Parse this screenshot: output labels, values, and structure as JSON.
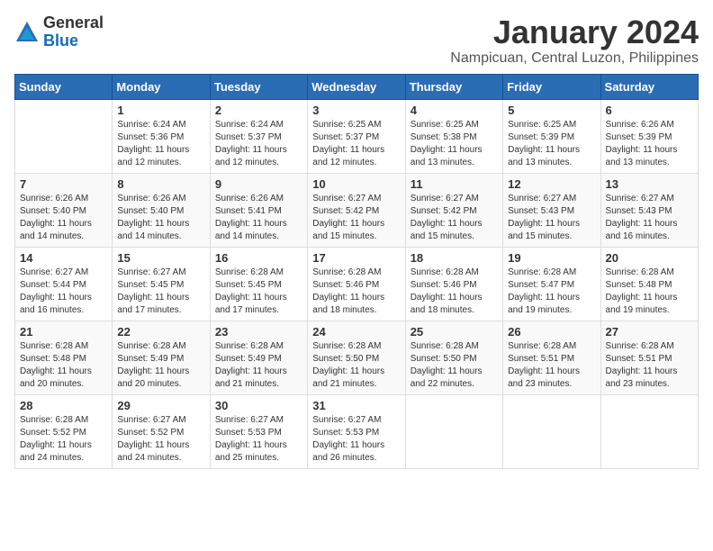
{
  "header": {
    "logo": {
      "general": "General",
      "blue": "Blue"
    },
    "title": "January 2024",
    "location": "Nampicuan, Central Luzon, Philippines"
  },
  "days_of_week": [
    "Sunday",
    "Monday",
    "Tuesday",
    "Wednesday",
    "Thursday",
    "Friday",
    "Saturday"
  ],
  "weeks": [
    [
      {
        "day": "",
        "info": ""
      },
      {
        "day": "1",
        "info": "Sunrise: 6:24 AM\nSunset: 5:36 PM\nDaylight: 11 hours\nand 12 minutes."
      },
      {
        "day": "2",
        "info": "Sunrise: 6:24 AM\nSunset: 5:37 PM\nDaylight: 11 hours\nand 12 minutes."
      },
      {
        "day": "3",
        "info": "Sunrise: 6:25 AM\nSunset: 5:37 PM\nDaylight: 11 hours\nand 12 minutes."
      },
      {
        "day": "4",
        "info": "Sunrise: 6:25 AM\nSunset: 5:38 PM\nDaylight: 11 hours\nand 13 minutes."
      },
      {
        "day": "5",
        "info": "Sunrise: 6:25 AM\nSunset: 5:39 PM\nDaylight: 11 hours\nand 13 minutes."
      },
      {
        "day": "6",
        "info": "Sunrise: 6:26 AM\nSunset: 5:39 PM\nDaylight: 11 hours\nand 13 minutes."
      }
    ],
    [
      {
        "day": "7",
        "info": "Sunrise: 6:26 AM\nSunset: 5:40 PM\nDaylight: 11 hours\nand 14 minutes."
      },
      {
        "day": "8",
        "info": "Sunrise: 6:26 AM\nSunset: 5:40 PM\nDaylight: 11 hours\nand 14 minutes."
      },
      {
        "day": "9",
        "info": "Sunrise: 6:26 AM\nSunset: 5:41 PM\nDaylight: 11 hours\nand 14 minutes."
      },
      {
        "day": "10",
        "info": "Sunrise: 6:27 AM\nSunset: 5:42 PM\nDaylight: 11 hours\nand 15 minutes."
      },
      {
        "day": "11",
        "info": "Sunrise: 6:27 AM\nSunset: 5:42 PM\nDaylight: 11 hours\nand 15 minutes."
      },
      {
        "day": "12",
        "info": "Sunrise: 6:27 AM\nSunset: 5:43 PM\nDaylight: 11 hours\nand 15 minutes."
      },
      {
        "day": "13",
        "info": "Sunrise: 6:27 AM\nSunset: 5:43 PM\nDaylight: 11 hours\nand 16 minutes."
      }
    ],
    [
      {
        "day": "14",
        "info": "Sunrise: 6:27 AM\nSunset: 5:44 PM\nDaylight: 11 hours\nand 16 minutes."
      },
      {
        "day": "15",
        "info": "Sunrise: 6:27 AM\nSunset: 5:45 PM\nDaylight: 11 hours\nand 17 minutes."
      },
      {
        "day": "16",
        "info": "Sunrise: 6:28 AM\nSunset: 5:45 PM\nDaylight: 11 hours\nand 17 minutes."
      },
      {
        "day": "17",
        "info": "Sunrise: 6:28 AM\nSunset: 5:46 PM\nDaylight: 11 hours\nand 18 minutes."
      },
      {
        "day": "18",
        "info": "Sunrise: 6:28 AM\nSunset: 5:46 PM\nDaylight: 11 hours\nand 18 minutes."
      },
      {
        "day": "19",
        "info": "Sunrise: 6:28 AM\nSunset: 5:47 PM\nDaylight: 11 hours\nand 19 minutes."
      },
      {
        "day": "20",
        "info": "Sunrise: 6:28 AM\nSunset: 5:48 PM\nDaylight: 11 hours\nand 19 minutes."
      }
    ],
    [
      {
        "day": "21",
        "info": "Sunrise: 6:28 AM\nSunset: 5:48 PM\nDaylight: 11 hours\nand 20 minutes."
      },
      {
        "day": "22",
        "info": "Sunrise: 6:28 AM\nSunset: 5:49 PM\nDaylight: 11 hours\nand 20 minutes."
      },
      {
        "day": "23",
        "info": "Sunrise: 6:28 AM\nSunset: 5:49 PM\nDaylight: 11 hours\nand 21 minutes."
      },
      {
        "day": "24",
        "info": "Sunrise: 6:28 AM\nSunset: 5:50 PM\nDaylight: 11 hours\nand 21 minutes."
      },
      {
        "day": "25",
        "info": "Sunrise: 6:28 AM\nSunset: 5:50 PM\nDaylight: 11 hours\nand 22 minutes."
      },
      {
        "day": "26",
        "info": "Sunrise: 6:28 AM\nSunset: 5:51 PM\nDaylight: 11 hours\nand 23 minutes."
      },
      {
        "day": "27",
        "info": "Sunrise: 6:28 AM\nSunset: 5:51 PM\nDaylight: 11 hours\nand 23 minutes."
      }
    ],
    [
      {
        "day": "28",
        "info": "Sunrise: 6:28 AM\nSunset: 5:52 PM\nDaylight: 11 hours\nand 24 minutes."
      },
      {
        "day": "29",
        "info": "Sunrise: 6:27 AM\nSunset: 5:52 PM\nDaylight: 11 hours\nand 24 minutes."
      },
      {
        "day": "30",
        "info": "Sunrise: 6:27 AM\nSunset: 5:53 PM\nDaylight: 11 hours\nand 25 minutes."
      },
      {
        "day": "31",
        "info": "Sunrise: 6:27 AM\nSunset: 5:53 PM\nDaylight: 11 hours\nand 26 minutes."
      },
      {
        "day": "",
        "info": ""
      },
      {
        "day": "",
        "info": ""
      },
      {
        "day": "",
        "info": ""
      }
    ]
  ]
}
